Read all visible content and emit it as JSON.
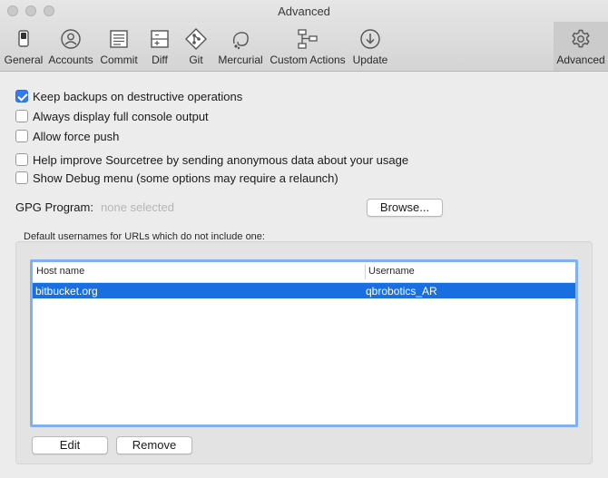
{
  "window": {
    "title": "Advanced"
  },
  "toolbar": {
    "items": [
      {
        "label": "General",
        "icon": "switch-icon"
      },
      {
        "label": "Accounts",
        "icon": "person-icon"
      },
      {
        "label": "Commit",
        "icon": "document-icon"
      },
      {
        "label": "Diff",
        "icon": "diff-icon"
      },
      {
        "label": "Git",
        "icon": "git-icon"
      },
      {
        "label": "Mercurial",
        "icon": "mercurial-icon"
      },
      {
        "label": "Custom Actions",
        "icon": "flowchart-icon"
      },
      {
        "label": "Update",
        "icon": "download-icon"
      },
      {
        "label": "Advanced",
        "icon": "gear-icon"
      }
    ],
    "selected": "Advanced"
  },
  "options": [
    {
      "label": "Keep backups on destructive operations",
      "checked": true
    },
    {
      "label": "Always display full console output",
      "checked": false
    },
    {
      "label": "Allow force push",
      "checked": false
    },
    {
      "label": "Help improve Sourcetree by sending anonymous data about your usage",
      "checked": false
    },
    {
      "label": "Show Debug menu (some options may require a relaunch)",
      "checked": false
    }
  ],
  "gpg": {
    "label": "GPG Program:",
    "value": "none selected",
    "browse_label": "Browse..."
  },
  "usernames": {
    "group_label": "Default usernames for URLs which do not include one:",
    "columns": [
      "Host name",
      "Username"
    ],
    "rows": [
      {
        "host": "bitbucket.org",
        "username": "qbrobotics_AR",
        "selected": true
      }
    ],
    "edit_label": "Edit",
    "remove_label": "Remove"
  },
  "colors": {
    "accent": "#2f7cf6",
    "selection": "#1a6fe0",
    "placeholder": "#b6b6b6"
  }
}
